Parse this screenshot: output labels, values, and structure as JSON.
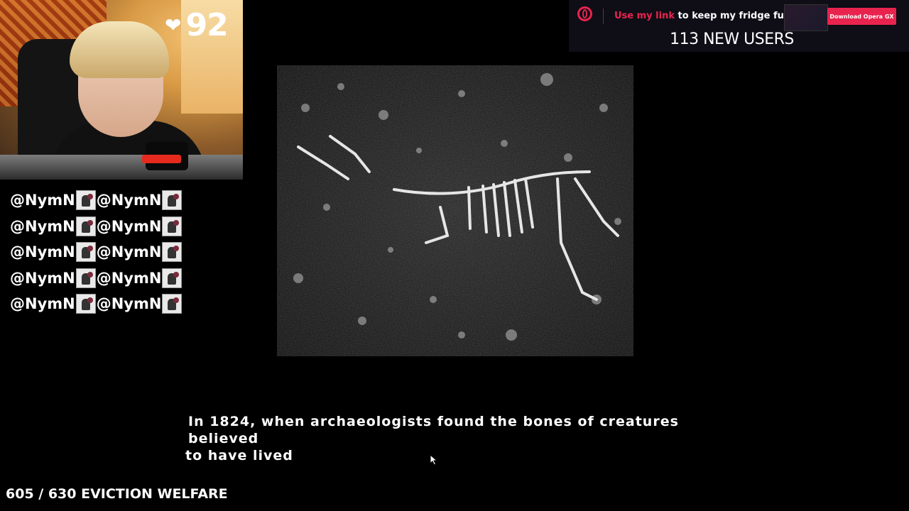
{
  "webcam": {
    "heart_count": "92",
    "heart_icon": "heart-icon"
  },
  "chat": {
    "rows": [
      [
        "@NymN",
        "@NymN"
      ],
      [
        "@NymN",
        "@NymN"
      ],
      [
        "@NymN",
        "@NymN"
      ],
      [
        "@NymN",
        "@NymN"
      ],
      [
        "@NymN",
        "@NymN"
      ]
    ]
  },
  "banner": {
    "link_text": "Use my link",
    "rest_text": " to keep my fridge full",
    "button_label": "Download Opera GX",
    "new_users": "113 NEW USERS",
    "accent_color": "#e8244e"
  },
  "video": {
    "subtitle_line1": "In 1824, when archaeologists found the bones of creatures believed",
    "subtitle_line2": "to have lived"
  },
  "goal": {
    "text": "605 / 630 EVICTION WELFARE"
  }
}
